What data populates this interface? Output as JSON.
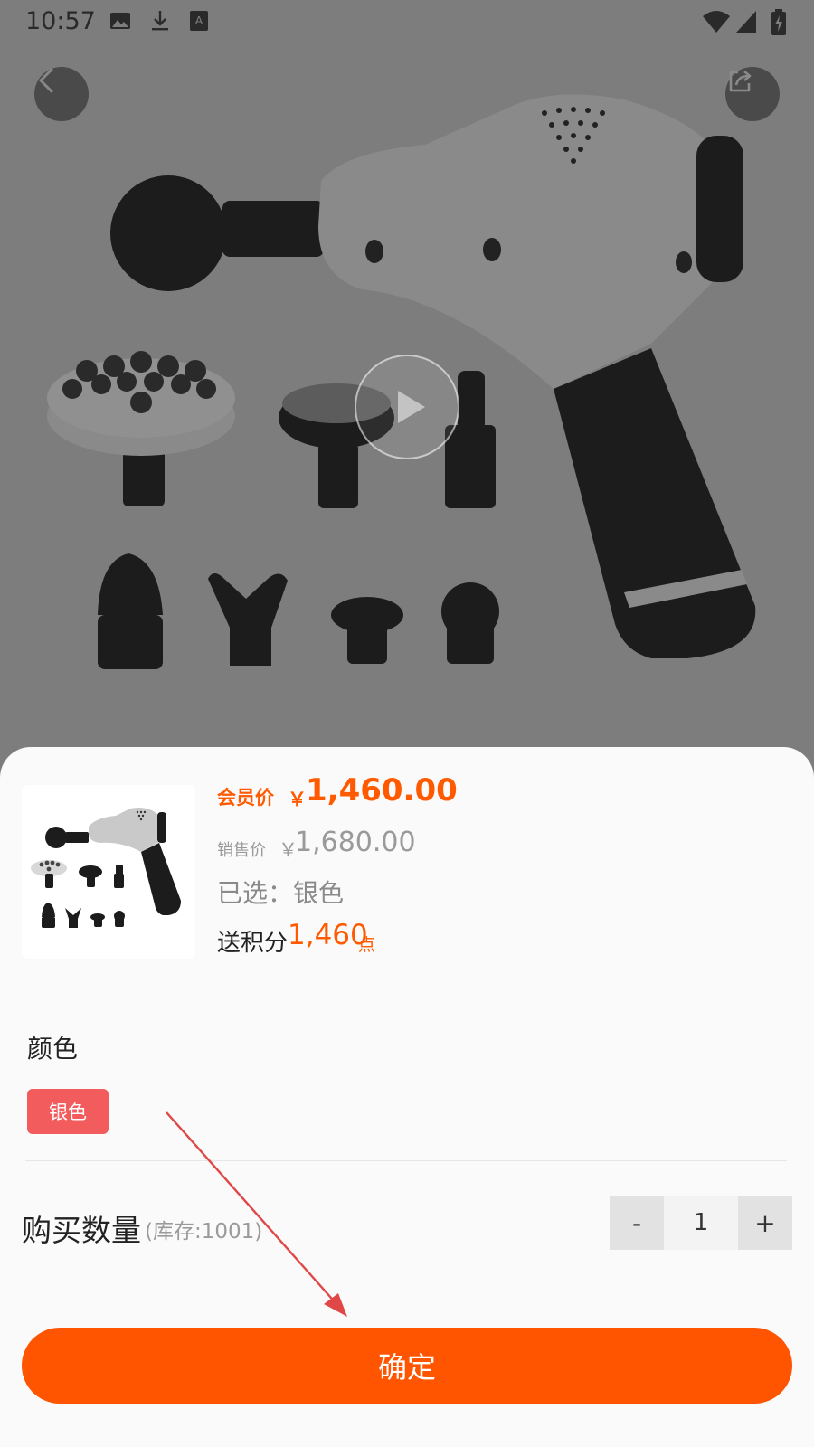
{
  "status_bar": {
    "time": "10:57",
    "icons": [
      "image-icon",
      "download-icon",
      "text-a-icon",
      "wifi-icon",
      "signal-icon",
      "battery-icon"
    ]
  },
  "header": {
    "back_icon": "chevron-left-icon",
    "share_icon": "share-icon",
    "video_icon": "play-icon"
  },
  "product": {
    "member_label": "会员价",
    "currency": "￥",
    "member_price": "1,460.00",
    "sale_label": "销售价",
    "sale_price": "1,680.00",
    "selected_text": "已选：银色",
    "points_label": "送积分",
    "points_value": "1,460",
    "points_unit": "点"
  },
  "options": {
    "color_title": "颜色",
    "color_value": "银色"
  },
  "quantity": {
    "label": "购买数量",
    "stock_text": "(库存:1001)",
    "minus": "-",
    "value": "1",
    "plus": "+"
  },
  "confirm_label": "确定",
  "colors": {
    "accent": "#ff5500",
    "price": "#ff5a00",
    "chip": "#f25c5c"
  }
}
